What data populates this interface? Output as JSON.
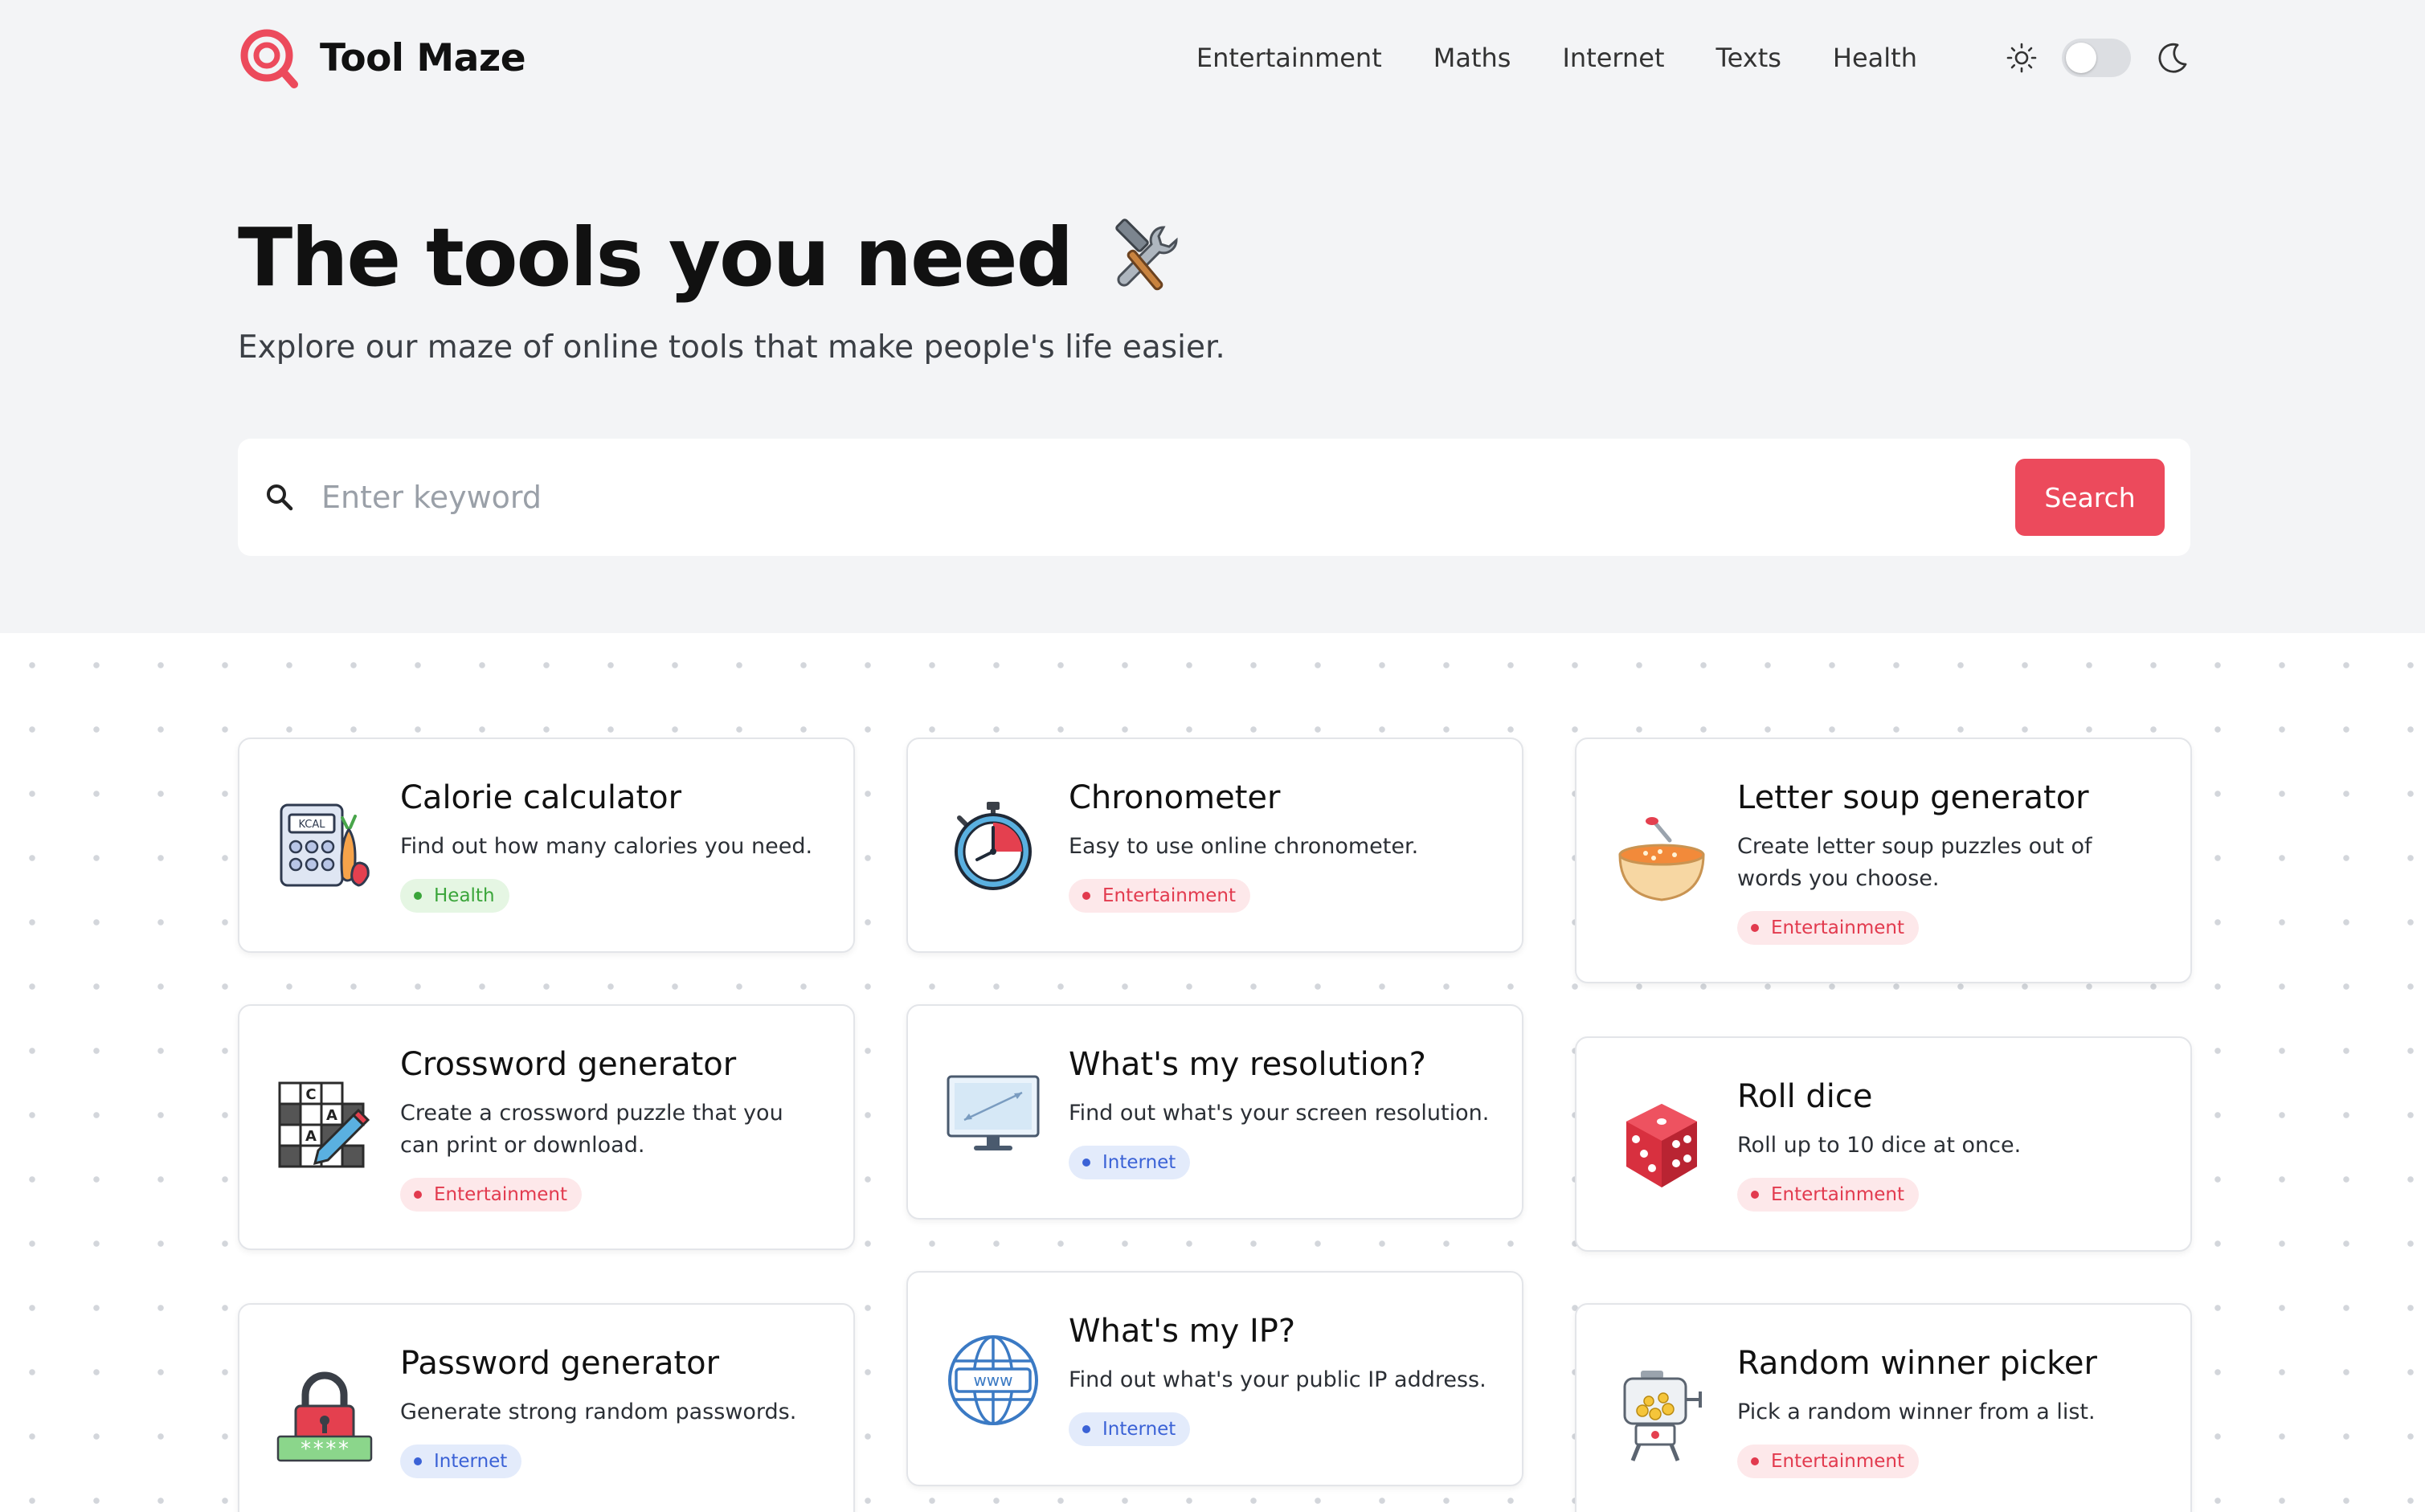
{
  "brand": {
    "name": "Tool Maze",
    "accent": "#ec4a5c"
  },
  "nav": {
    "items": [
      {
        "label": "Entertainment"
      },
      {
        "label": "Maths"
      },
      {
        "label": "Internet"
      },
      {
        "label": "Texts"
      },
      {
        "label": "Health"
      }
    ],
    "theme_toggle": {
      "light_icon": "sun-icon",
      "dark_icon": "moon-icon",
      "state": "light"
    }
  },
  "hero": {
    "title": "The tools you need",
    "title_icon": "hammer-and-wrench-icon",
    "subtitle": "Explore our maze of online tools that make people's life easier."
  },
  "search": {
    "placeholder": "Enter keyword",
    "value": "",
    "button_label": "Search"
  },
  "tools": [
    {
      "title": "Calorie calculator",
      "description": "Find out how many calories you need.",
      "tag": "Health",
      "icon": "calorie-calculator-icon"
    },
    {
      "title": "Chronometer",
      "description": "Easy to use online chronometer.",
      "tag": "Entertainment",
      "icon": "stopwatch-icon"
    },
    {
      "title": "Letter soup generator",
      "description": "Create letter soup puzzles out of words you choose.",
      "tag": "Entertainment",
      "icon": "soup-bowl-icon"
    },
    {
      "title": "Crossword generator",
      "description": "Create a crossword puzzle that you can print or download.",
      "tag": "Entertainment",
      "icon": "crossword-icon"
    },
    {
      "title": "What's my resolution?",
      "description": "Find out what's your screen resolution.",
      "tag": "Internet",
      "icon": "monitor-icon"
    },
    {
      "title": "Roll dice",
      "description": "Roll up to 10 dice at once.",
      "tag": "Entertainment",
      "icon": "dice-icon"
    },
    {
      "title": "Password generator",
      "description": "Generate strong random passwords.",
      "tag": "Internet",
      "icon": "padlock-icon",
      "password_mask": "****"
    },
    {
      "title": "What's my IP?",
      "description": "Find out what's your public IP address.",
      "tag": "Internet",
      "icon": "globe-icon",
      "globe_label": "www"
    },
    {
      "title": "Random winner picker",
      "description": "Pick a random winner from a list.",
      "tag": "Entertainment",
      "icon": "lottery-machine-icon"
    }
  ]
}
